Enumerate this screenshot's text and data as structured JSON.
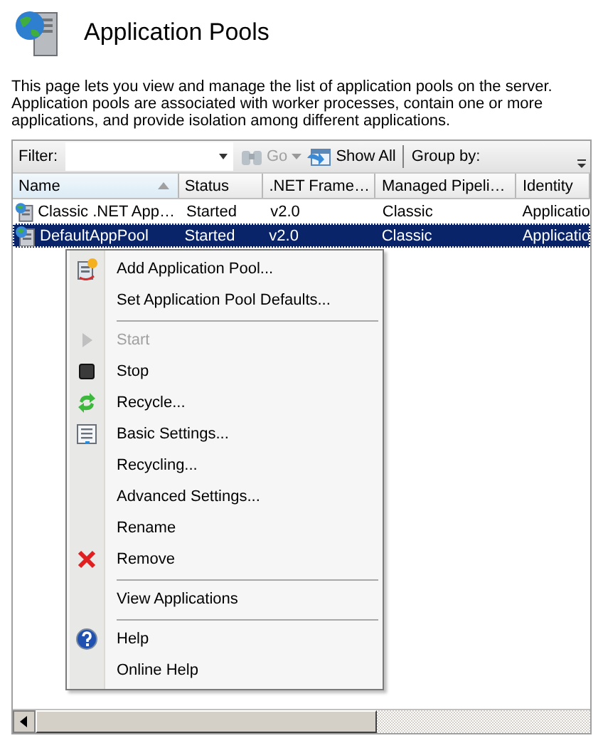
{
  "page": {
    "title": "Application Pools",
    "description": "This page lets you view and manage the list of application pools on the server. Application pools are associated with worker processes, contain one or more applications, and provide isolation among different applications."
  },
  "toolbar": {
    "filter_label": "Filter:",
    "go": {
      "label": "Go",
      "disabled": true
    },
    "show_all": "Show All",
    "group_by_label": "Group by:"
  },
  "table": {
    "columns": [
      {
        "label": "Name",
        "sorted": true
      },
      {
        "label": "Status",
        "sorted": false
      },
      {
        "label": ".NET Frame…",
        "sorted": false
      },
      {
        "label": "Managed Pipeli…",
        "sorted": false
      },
      {
        "label": "Identity",
        "sorted": false
      }
    ],
    "rows": [
      {
        "cells": [
          "Classic .NET App…",
          "Started",
          "v2.0",
          "Classic",
          "Applicatio"
        ],
        "selected": false
      },
      {
        "cells": [
          "DefaultAppPool",
          "Started",
          "v2.0",
          "Classic",
          "Applicatio"
        ],
        "selected": true
      }
    ]
  },
  "context_menu": {
    "items": [
      {
        "kind": "item",
        "label": "Add Application Pool...",
        "disabled": false
      },
      {
        "kind": "item",
        "label": "Set Application Pool Defaults...",
        "disabled": false
      },
      {
        "kind": "separator"
      },
      {
        "kind": "item",
        "label": "Start",
        "disabled": true
      },
      {
        "kind": "item",
        "label": "Stop",
        "disabled": false
      },
      {
        "kind": "item",
        "label": "Recycle...",
        "disabled": false
      },
      {
        "kind": "item",
        "label": "Basic Settings...",
        "disabled": false
      },
      {
        "kind": "item",
        "label": "Recycling...",
        "disabled": false
      },
      {
        "kind": "item",
        "label": "Advanced Settings...",
        "disabled": false
      },
      {
        "kind": "item",
        "label": "Rename",
        "disabled": false
      },
      {
        "kind": "item",
        "label": "Remove",
        "disabled": false
      },
      {
        "kind": "separator"
      },
      {
        "kind": "item",
        "label": "View Applications",
        "disabled": false
      },
      {
        "kind": "separator"
      },
      {
        "kind": "item",
        "label": "Help",
        "disabled": false
      },
      {
        "kind": "item",
        "label": "Online Help",
        "disabled": false
      }
    ]
  }
}
